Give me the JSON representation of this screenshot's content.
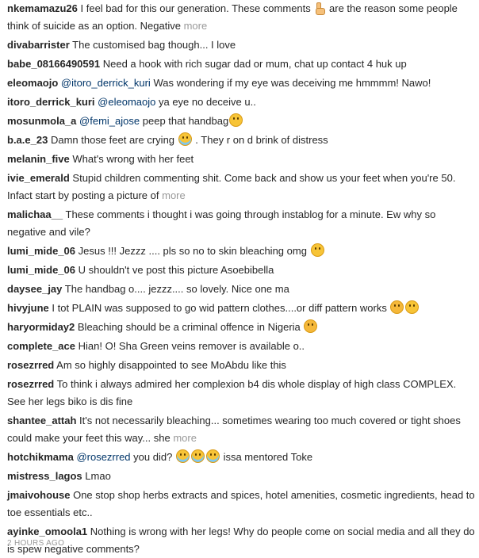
{
  "comments": [
    {
      "user": "nkemamazu26",
      "pre": "I feel bad for this our generation. These comments",
      "post": "are the reason some people think of suicide as an option. Negative",
      "more": "more",
      "icon": "pointing-down-emoji"
    },
    {
      "user": "divabarrister",
      "text": "The customised bag though... I love"
    },
    {
      "user": "babe_08166490591",
      "text": "Need a hook with rich sugar dad or mum, chat up contact 4 huk up"
    },
    {
      "user": "eleomaojo",
      "mention": "@itoro_derrick_kuri",
      "text": "Was wondering if my eye was deceiving me hmmmm! Nawo!"
    },
    {
      "user": "itoro_derrick_kuri",
      "mention": "@eleomaojo",
      "text": "ya eye no deceive u.."
    },
    {
      "user": "mosunmola_a",
      "mention": "@femi_ajose",
      "text": "peep that handbag",
      "icon": "wink-emoji"
    },
    {
      "user": "b.a.e_23",
      "pre": "Damn those feet are crying",
      "post": ". They r on d brink of distress",
      "icon": "crying-emoji"
    },
    {
      "user": "melanin_five",
      "text": "What's wrong with her feet"
    },
    {
      "user": "ivie_emerald",
      "text": "Stupid children commenting shit. Come back and show us your feet when you're 50. Infact start by posting a picture of",
      "more": "more"
    },
    {
      "user": "malichaa__",
      "text": "These comments i thought i was going through instablog for a minute. Ew why so negative and vile?"
    },
    {
      "user": "lumi_mide_06",
      "text": "Jesus !!! Jezzz .... pls so no to skin bleaching omg",
      "icon": "surprised-emoji"
    },
    {
      "user": "lumi_mide_06",
      "text": "U shouldn't ve post this picture Asoebibella"
    },
    {
      "user": "daysee_jay",
      "text": "The handbag o.... jezzz.... so lovely. Nice one ma"
    },
    {
      "user": "hivyjune",
      "text": "I tot PLAIN was supposed to go wid pattern clothes....or diff pattern works",
      "icon": "sad-emoji",
      "icon2": "confused-emoji"
    },
    {
      "user": "haryormiday2",
      "text": "Bleaching should be a criminal offence in Nigeria",
      "icon": "worried-emoji"
    },
    {
      "user": "complete_ace",
      "text": "Hian! O! Sha Green veins remover is available o.."
    },
    {
      "user": "rosezrred",
      "text": "Am so highly disappointed to see MoAbdu like this"
    },
    {
      "user": "rosezrred",
      "text": "To think i always admired her complexion b4 dis whole display of high class COMPLEX. See her legs biko is dis fine"
    },
    {
      "user": "shantee_attah",
      "text": "It's not necessarily bleaching... sometimes wearing too much covered or tight shoes could make your feet this way... she",
      "more": "more"
    },
    {
      "user": "hotchikmama",
      "mention": "@rosezrred",
      "text": "you did?",
      "post": "issa mentored Toke",
      "icon": "laughing-tears-emoji"
    },
    {
      "user": "mistress_lagos",
      "text": "Lmao"
    },
    {
      "user": "jmaivohouse",
      "text": "One stop shop herbs extracts and spices, hotel amenities, cosmetic ingredients, head to toe essentials etc.."
    },
    {
      "user": "ayinke_omoola1",
      "text": "Nothing is wrong with her legs! Why do people come on social media and all they do is spew negative comments?"
    }
  ],
  "timestamp": "2 HOURS AGO"
}
